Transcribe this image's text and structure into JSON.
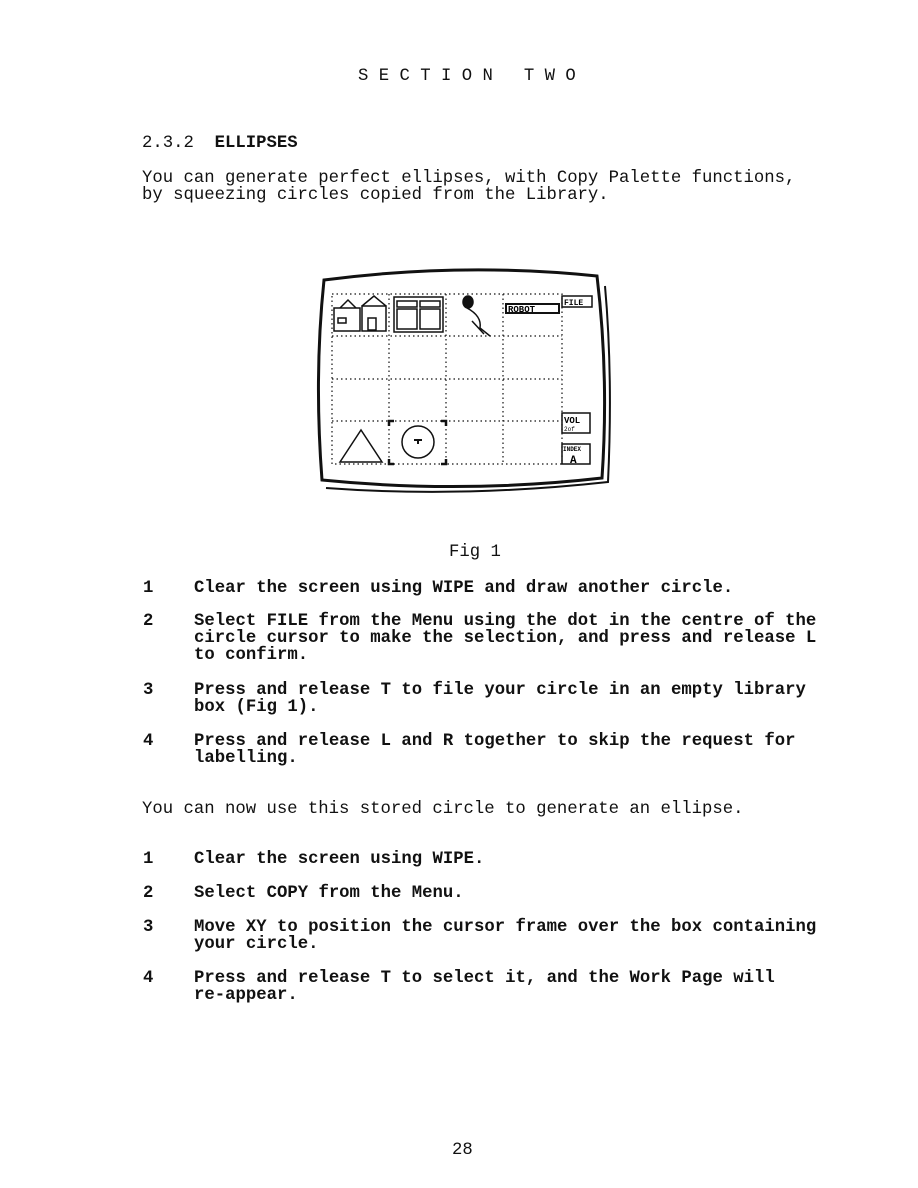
{
  "header": {
    "section": "S E C T I O N   T W O"
  },
  "heading": {
    "number": "2.3.2",
    "title": "ELLIPSES"
  },
  "intro": [
    "You can generate perfect ellipses, with Copy Palette functions,",
    "by squeezing circles copied from the Library."
  ],
  "figure": {
    "caption": "Fig 1",
    "labels": {
      "file": "FILE",
      "robot": "ROBOT",
      "vol": "VOL",
      "vol_sub": "2of",
      "index": "INDEX",
      "index_letter": "A"
    }
  },
  "steps1": [
    {
      "n": "1",
      "text": "Clear the screen using WIPE and draw another circle."
    },
    {
      "n": "2",
      "text": "Select FILE from the Menu using the dot in the centre of the\ncircle cursor to make the selection, and press and release L\nto confirm."
    },
    {
      "n": "3",
      "text": "Press and release T to file your circle in an empty library\nbox (Fig 1)."
    },
    {
      "n": "4",
      "text": "Press and release L and R together to skip the request for\nlabelling."
    }
  ],
  "middle": "You can now use this stored circle to generate an ellipse.",
  "steps2": [
    {
      "n": "1",
      "text": "Clear the screen using WIPE."
    },
    {
      "n": "2",
      "text": "Select COPY from the Menu."
    },
    {
      "n": "3",
      "text": "Move XY to position the cursor frame over the box containing\nyour circle."
    },
    {
      "n": "4",
      "text": "Press and release T to select it, and the Work Page will\nre-appear."
    }
  ],
  "footer": {
    "page_number": "28"
  }
}
